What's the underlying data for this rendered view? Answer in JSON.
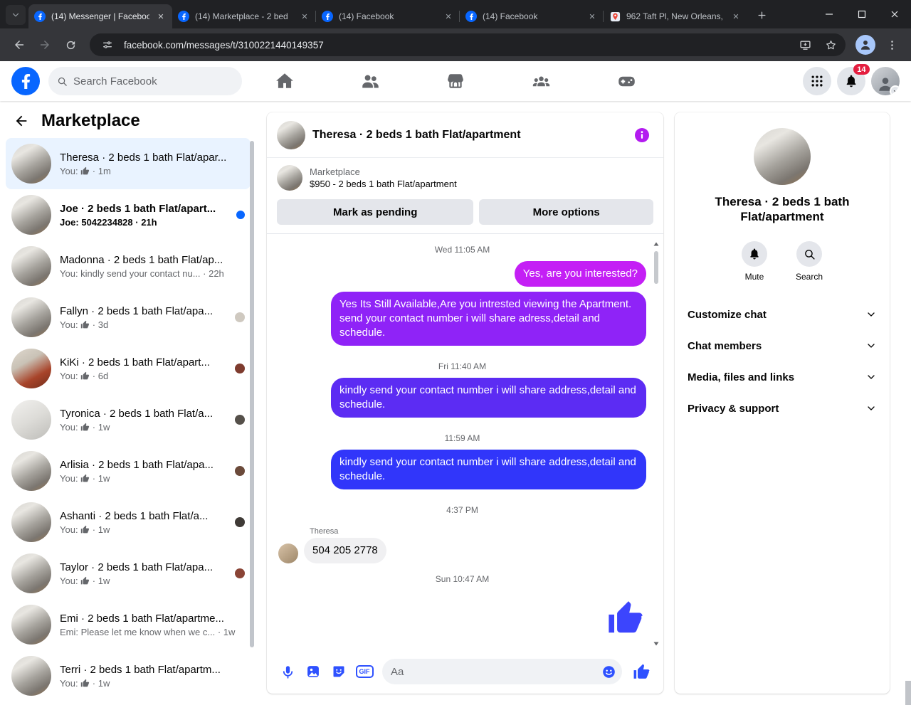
{
  "browser": {
    "tabs": [
      {
        "title": "(14) Messenger | Faceboo",
        "active": true
      },
      {
        "title": "(14) Marketplace - 2 bed",
        "active": false
      },
      {
        "title": "(14) Facebook",
        "active": false
      },
      {
        "title": "(14) Facebook",
        "active": false
      },
      {
        "title": "962 Taft Pl, New Orleans,",
        "active": false
      }
    ],
    "url": "facebook.com/messages/t/3100221440149357"
  },
  "header": {
    "search_placeholder": "Search Facebook",
    "notification_badge": "14"
  },
  "theme": {
    "unread_dot": "#0866ff",
    "badge_red": "#e41e3f",
    "facebook_blue": "#0866ff"
  },
  "sidebar": {
    "title": "Marketplace",
    "chats": [
      {
        "name": "Theresa · 2 beds 1 bath Flat/apar...",
        "preview": "You: 👍 · 1m",
        "state": "selected"
      },
      {
        "name": "Joe · 2 beds 1 bath Flat/apart...",
        "preview": "Joe: 5042234828 · 21h",
        "state": "unread"
      },
      {
        "name": "Madonna · 2 beds 1 bath Flat/ap...",
        "preview": "You: kindly send your contact nu... · 22h",
        "state": ""
      },
      {
        "name": "Fallyn · 2 beds 1 bath Flat/apa...",
        "preview": "You: 👍 · 3d",
        "state": "seen"
      },
      {
        "name": "KiKi · 2 beds 1 bath Flat/apart...",
        "preview": "You: 👍 · 6d",
        "state": "seen"
      },
      {
        "name": "Tyronica · 2 beds 1 bath Flat/a...",
        "preview": "You: 👍 · 1w",
        "state": "seen"
      },
      {
        "name": "Arlisia · 2 beds 1 bath Flat/apa...",
        "preview": "You: 👍 · 1w",
        "state": "seen"
      },
      {
        "name": "Ashanti · 2 beds 1 bath Flat/a...",
        "preview": "You: 👍 · 1w",
        "state": "seen"
      },
      {
        "name": "Taylor · 2 beds 1 bath Flat/apa...",
        "preview": "You: 👍 · 1w",
        "state": "seen"
      },
      {
        "name": "Emi · 2 beds 1 bath Flat/apartme...",
        "preview": "Emi: Please let me know when we c... · 1w",
        "state": ""
      },
      {
        "name": "Terri · 2 beds 1 bath Flat/apartm...",
        "preview": "You: 👍 · 1w",
        "state": ""
      }
    ]
  },
  "chat": {
    "header": {
      "title": "Theresa · 2 beds 1 bath Flat/apartment",
      "info_color": "#b31bf0"
    },
    "context": {
      "label": "Marketplace",
      "detail": "$950 - 2 beds 1 bath Flat/apartment",
      "mark_pending_label": "Mark as pending",
      "more_options_label": "More options"
    },
    "messages": [
      {
        "type": "timestamp",
        "text": "Wed 11:05 AM"
      },
      {
        "type": "sent",
        "text": "Yes, are you interested?",
        "color": "#c41ff5"
      },
      {
        "type": "sent",
        "text": "Yes Its Still Available,Are you intrested viewing the Apartment. send your contact number i will share adress,detail and schedule.",
        "color": "#8f23f7"
      },
      {
        "type": "timestamp",
        "text": "Fri 11:40 AM"
      },
      {
        "type": "sent",
        "text": "kindly send your contact number i will share address,detail and schedule.",
        "color": "#5c2cf3"
      },
      {
        "type": "timestamp",
        "text": "11:59 AM"
      },
      {
        "type": "sent",
        "text": "kindly send your contact number i will share address,detail and schedule.",
        "color": "#3136fa"
      },
      {
        "type": "timestamp",
        "text": "4:37 PM"
      },
      {
        "type": "received",
        "sender": "Theresa",
        "text": "504 205 2778"
      },
      {
        "type": "timestamp",
        "text": "Sun 10:47 AM"
      },
      {
        "type": "like",
        "text": "👍",
        "color": "#3c45fd"
      }
    ],
    "composer": {
      "placeholder": "Aa",
      "gif_label": "GIF",
      "accent": "#2e51ff"
    }
  },
  "details": {
    "title": "Theresa · 2 beds 1 bath Flat/apartment",
    "mute_label": "Mute",
    "search_label": "Search",
    "sections": [
      {
        "label": "Customize chat"
      },
      {
        "label": "Chat members"
      },
      {
        "label": "Media, files and links"
      },
      {
        "label": "Privacy & support"
      }
    ]
  }
}
